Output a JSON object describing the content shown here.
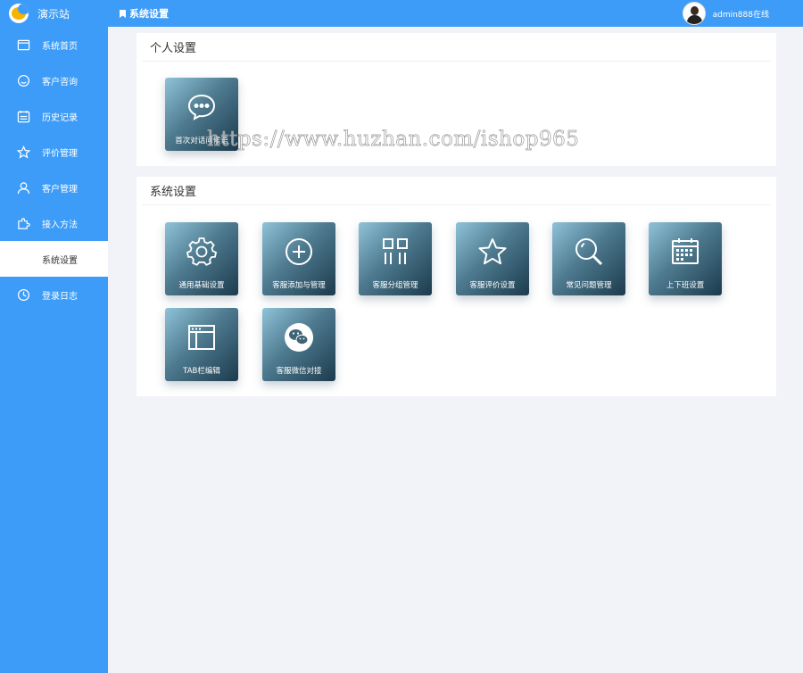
{
  "app": {
    "name": "演示站",
    "brand_color": "#3d9cf7"
  },
  "header": {
    "title": "系统设置",
    "user_status": "admin888在线"
  },
  "sidebar": {
    "items": [
      {
        "label": "系统首页",
        "icon": "window-icon"
      },
      {
        "label": "客户咨询",
        "icon": "smile-icon"
      },
      {
        "label": "历史记录",
        "icon": "calendar-list-icon"
      },
      {
        "label": "评价管理",
        "icon": "star-icon"
      },
      {
        "label": "客户管理",
        "icon": "user-icon"
      },
      {
        "label": "接入方法",
        "icon": "puzzle-icon"
      },
      {
        "label": "系统设置",
        "icon": "gear-icon",
        "active": true
      },
      {
        "label": "登录日志",
        "icon": "clock-icon"
      }
    ]
  },
  "personal": {
    "title": "个人设置",
    "tiles": [
      {
        "label": "首次对话问候语",
        "icon": "chat-bubble-icon"
      }
    ]
  },
  "system": {
    "title": "系统设置",
    "tiles": [
      {
        "label": "通用基础设置",
        "icon": "gear-icon"
      },
      {
        "label": "客服添加与管理",
        "icon": "plus-circle-icon"
      },
      {
        "label": "客服分组管理",
        "icon": "group-grid-icon"
      },
      {
        "label": "客服评价设置",
        "icon": "star-icon"
      },
      {
        "label": "常见问题管理",
        "icon": "search-icon"
      },
      {
        "label": "上下班设置",
        "icon": "calendar-icon"
      },
      {
        "label": "TAB栏编辑",
        "icon": "browser-tab-icon"
      },
      {
        "label": "客服微信对接",
        "icon": "wechat-icon"
      }
    ]
  },
  "watermark": "https://www.huzhan.com/ishop965"
}
